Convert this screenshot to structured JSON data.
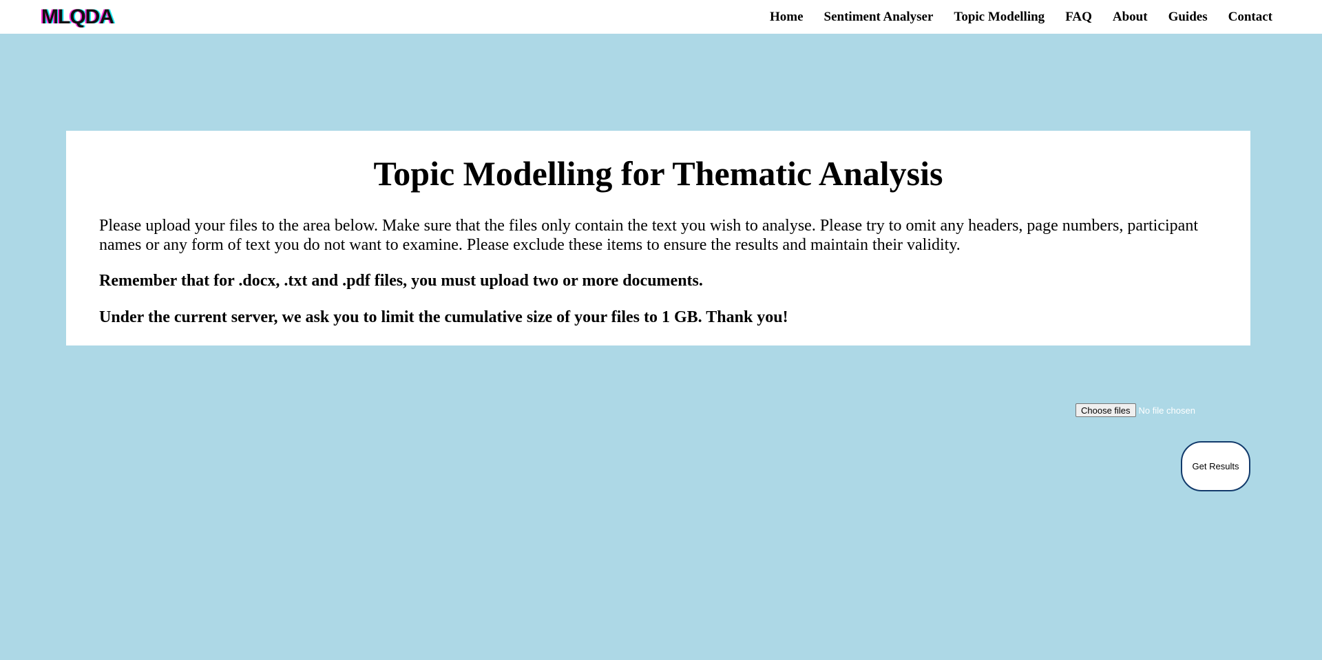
{
  "header": {
    "logo_text": "MLQDA",
    "nav": [
      {
        "label": "Home"
      },
      {
        "label": "Sentiment Analyser"
      },
      {
        "label": "Topic Modelling"
      },
      {
        "label": "FAQ"
      },
      {
        "label": "About"
      },
      {
        "label": "Guides"
      },
      {
        "label": "Contact"
      }
    ]
  },
  "main": {
    "title": "Topic Modelling for Thematic Analysis",
    "intro": "Please upload your files to the area below. Make sure that the files only contain the text you wish to analyse. Please try to omit any headers, page numbers, participant names or any form of text you do not want to examine. Please exclude these items to ensure the results and maintain their validity.",
    "note_docs": "Remember that for .docx, .txt and .pdf files, you must upload two or more documents.",
    "note_size": "Under the current server, we ask you to limit the cumulative size of your files to 1 GB. Thank you!"
  },
  "upload": {
    "choose_label": "Choose files",
    "status": "No file chosen",
    "submit_label": "Get Results"
  },
  "colors": {
    "background": "#add8e6",
    "panel": "#ffffff",
    "button_border": "#123a6b"
  }
}
